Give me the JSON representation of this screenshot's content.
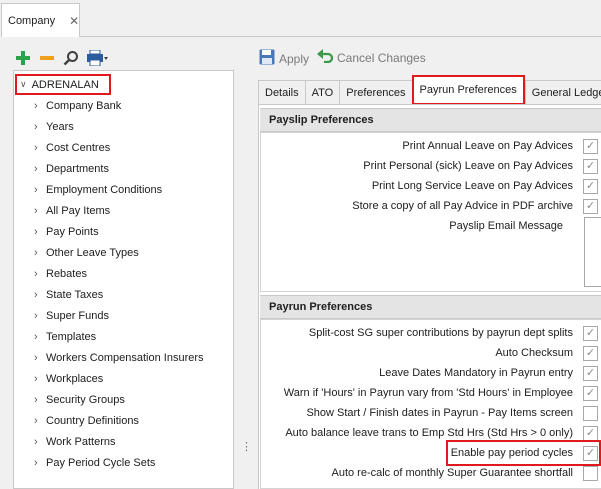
{
  "window_tab": {
    "label": "Company",
    "close_glyph": "✕"
  },
  "left_toolbar": {
    "icons": [
      "add-icon",
      "remove-icon",
      "search-icon",
      "print-icon"
    ],
    "colors": {
      "add": "#2ea24a",
      "remove": "#f0a020",
      "search": "#404040",
      "print": "#2b5c9e"
    }
  },
  "tree": {
    "root_label": "ADRENALAN",
    "items": [
      "Company Bank",
      "Years",
      "Cost Centres",
      "Departments",
      "Employment Conditions",
      "All Pay Items",
      "Pay Points",
      "Other Leave Types",
      "Rebates",
      "State Taxes",
      "Super Funds",
      "Templates",
      "Workers Compensation Insurers",
      "Workplaces",
      "Security Groups",
      "Country Definitions",
      "Work Patterns",
      "Pay Period Cycle Sets"
    ]
  },
  "toolbar": {
    "apply_label": "Apply",
    "cancel_label": "Cancel Changes"
  },
  "tabs": [
    "Details",
    "ATO",
    "Preferences",
    "Payrun Preferences",
    "General Ledger"
  ],
  "active_tab": "Payrun Preferences",
  "payslip_section": {
    "title": "Payslip Preferences",
    "options": [
      {
        "label": "Print Annual Leave on Pay Advices",
        "checked": true
      },
      {
        "label": "Print Personal (sick) Leave on Pay Advices",
        "checked": true
      },
      {
        "label": "Print Long Service Leave on Pay Advices",
        "checked": true
      },
      {
        "label": "Store a copy of all Pay Advice in PDF archive",
        "checked": true
      }
    ],
    "email_message_label": "Payslip Email Message"
  },
  "payrun_section": {
    "title": "Payrun Preferences",
    "options": [
      {
        "label": "Split-cost SG super contributions by payrun dept splits",
        "checked": true
      },
      {
        "label": "Auto Checksum",
        "checked": true
      },
      {
        "label": "Leave Dates Mandatory in Payrun entry",
        "checked": true
      },
      {
        "label": "Warn if 'Hours' in Payrun vary from 'Std Hours' in Employee",
        "checked": true
      },
      {
        "label": "Show Start / Finish dates in Payrun - Pay Items screen",
        "checked": false
      },
      {
        "label": "Auto balance leave trans to Emp Std Hrs (Std Hrs > 0 only)",
        "checked": true
      },
      {
        "label": "Enable pay period cycles",
        "checked": true
      },
      {
        "label": "Auto re-calc of monthly Super Guarantee shortfall",
        "checked": false
      }
    ]
  },
  "check_glyph": "✓",
  "highlight_color": "#e0191c"
}
